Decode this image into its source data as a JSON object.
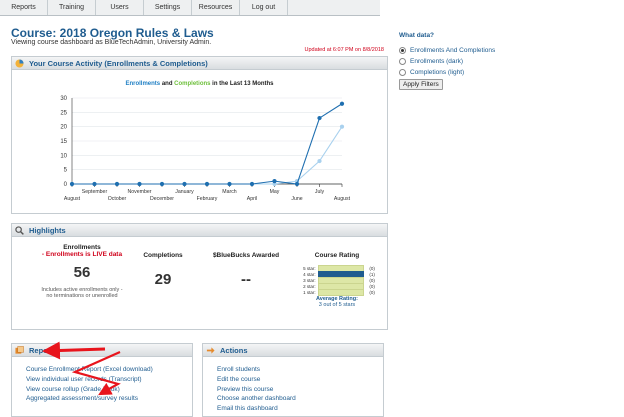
{
  "nav": [
    "Reports",
    "Training",
    "Users",
    "Settings",
    "Resources",
    "Log out"
  ],
  "course": {
    "title": "Course: 2018 Oregon Rules & Laws",
    "subtitle": "Viewing course dashboard as BlueTechAdmin, University Admin.",
    "updated": "Updated at 6:07 PM on 8/8/2018"
  },
  "activity": {
    "heading": "Your Course Activity (Enrollments & Completions)",
    "chart_title_a": "Enrollments",
    "chart_title_and": " and ",
    "chart_title_b": "Completions",
    "chart_title_rest": " in the Last 13 Months"
  },
  "chart_data": {
    "type": "line",
    "title": "Enrollments and Completions in the Last 13 Months",
    "categories": [
      "August",
      "September",
      "October",
      "November",
      "December",
      "January",
      "February",
      "March",
      "April",
      "May",
      "June",
      "July",
      "August"
    ],
    "ylim": [
      0,
      30
    ],
    "yticks": [
      0,
      5,
      10,
      15,
      20,
      25,
      30
    ],
    "grid": true,
    "series": [
      {
        "name": "Enrollments",
        "color": "#1f6fb0",
        "values": [
          0,
          0,
          0,
          0,
          0,
          0,
          0,
          0,
          0,
          1,
          0,
          23,
          28
        ]
      },
      {
        "name": "Completions",
        "color": "#a9d1ee",
        "values": [
          0,
          0,
          0,
          0,
          0,
          0,
          0,
          0,
          0,
          0,
          1,
          8,
          20
        ]
      }
    ]
  },
  "highlights": {
    "heading": "Highlights",
    "enrollments_label": "Enrollments",
    "enrollments_live": "- Enrollments is LIVE data",
    "enrollments_value": "56",
    "enrollments_note": "Includes active enrollments only - no terminations or unenrolled",
    "completions_label": "Completions",
    "completions_value": "29",
    "bluebucks_label": "$BlueBucks Awarded",
    "bluebucks_value": "--",
    "rating_label": "Course Rating",
    "rating_rows": [
      {
        "label": "5 star:",
        "count": "(0)",
        "active": false
      },
      {
        "label": "4 star:",
        "count": "(1)",
        "active": true
      },
      {
        "label": "3 star:",
        "count": "(0)",
        "active": false
      },
      {
        "label": "2 star:",
        "count": "(0)",
        "active": false
      },
      {
        "label": "1 star:",
        "count": "(0)",
        "active": false
      }
    ],
    "avg_label": "Average Rating:",
    "avg_value": "3 out of 5 stars"
  },
  "reports": {
    "heading": "Reports",
    "links": [
      "Course Enrollment Report (Excel download)",
      "View individual user records (Transcript)",
      "View course rollup (Grade Book)",
      "Aggregated assessment/survey results"
    ]
  },
  "actions": {
    "heading": "Actions",
    "links": [
      "Enroll students",
      "Edit the course",
      "Preview this course",
      "Choose another dashboard",
      "Email this dashboard"
    ]
  },
  "filter": {
    "title": "What data?",
    "options": [
      "Enrollments And Completions",
      "Enrollments (dark)",
      "Completions (light)"
    ],
    "selected": 0,
    "apply": "Apply Filters"
  },
  "colors": {
    "accent": "#1f5c8f",
    "alert": "#d0021b",
    "annotation_arrow": "#e8141c"
  }
}
